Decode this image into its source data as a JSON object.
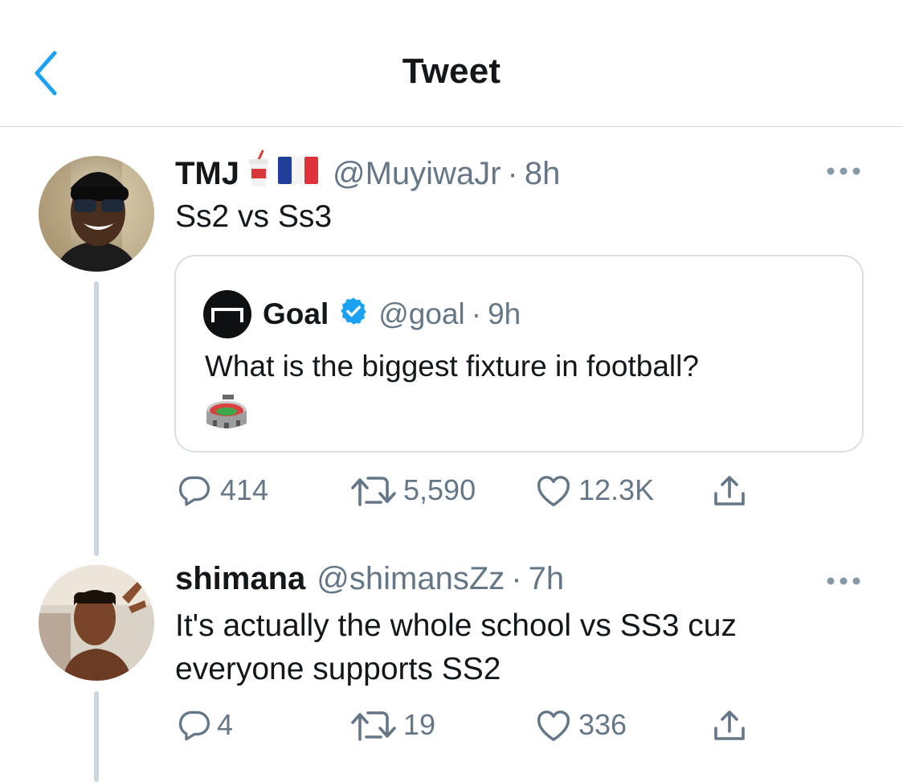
{
  "header": {
    "title": "Tweet"
  },
  "tweets": [
    {
      "name": "TMJ",
      "handle": "@MuyiwaJr",
      "dot": "·",
      "time": "8h",
      "text": "Ss2 vs Ss3",
      "quote": {
        "name": "Goal",
        "handle": "@goal",
        "dot": "·",
        "time": "9h",
        "text": "What is the biggest fixture in football?"
      },
      "stats": {
        "replies": "414",
        "retweets": "5,590",
        "likes": "12.3K"
      }
    },
    {
      "name": "shimana",
      "handle": "@shimansZz",
      "dot": "·",
      "time": "7h",
      "text_line1": "It's actually the whole school vs SS3 cuz",
      "text_line2": "everyone supports SS2",
      "stats": {
        "replies": "4",
        "retweets": "19",
        "likes": "336"
      }
    }
  ],
  "colors": {
    "accent": "#1da1f2",
    "secondary_text": "#657786",
    "border": "#d8dfe4",
    "thread_line": "#ccd6dd"
  },
  "icons": [
    "back-chevron-icon",
    "more-icon",
    "verified-icon",
    "reply-icon",
    "retweet-icon",
    "like-icon",
    "share-icon",
    "cup-emoji",
    "france-flag-emoji",
    "stadium-emoji"
  ]
}
